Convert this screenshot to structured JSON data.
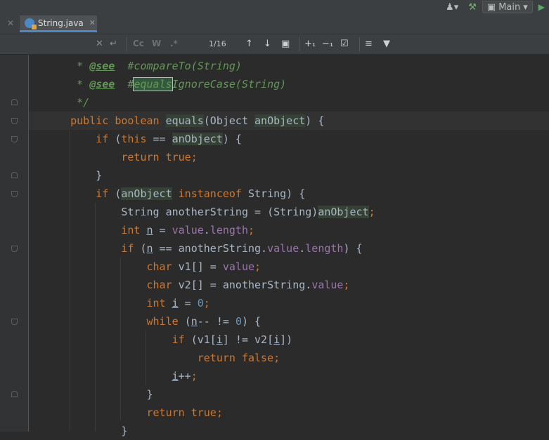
{
  "toolbar": {
    "run_config": "Main"
  },
  "tabs": [
    {
      "label": "String.java"
    }
  ],
  "search": {
    "match_case_label": "Cc",
    "words_label": "W",
    "regex_label": ".*",
    "match_count": "1/16"
  },
  "code": {
    "lines": [
      [
        {
          "t": "     * ",
          "c": "cm"
        },
        {
          "t": "@see",
          "c": "cmtag"
        },
        {
          "t": "  #compareTo(String)",
          "c": "cm"
        }
      ],
      [
        {
          "t": "     * ",
          "c": "cm"
        },
        {
          "t": "@see",
          "c": "cmtag"
        },
        {
          "t": "  #",
          "c": "cm"
        },
        {
          "t": "equals",
          "c": "cm hl-box"
        },
        {
          "t": "IgnoreCase(String)",
          "c": "cm"
        }
      ],
      [
        {
          "t": "     */",
          "c": "cm"
        }
      ],
      [
        {
          "t": "    public boolean ",
          "c": "kw"
        },
        {
          "t": "equals",
          "c": "hl"
        },
        {
          "t": "(Object "
        },
        {
          "t": "anObject",
          "c": "hl"
        },
        {
          "t": ") {"
        }
      ],
      [
        {
          "t": "        "
        },
        {
          "t": "if ",
          "c": "kw"
        },
        {
          "t": "("
        },
        {
          "t": "this ",
          "c": "kw"
        },
        {
          "t": "== "
        },
        {
          "t": "anObject",
          "c": "hl"
        },
        {
          "t": ") {"
        }
      ],
      [
        {
          "t": "            "
        },
        {
          "t": "return true",
          "c": "kw"
        },
        {
          "t": ";",
          "c": "kw"
        }
      ],
      [
        {
          "t": "        }"
        }
      ],
      [
        {
          "t": "        "
        },
        {
          "t": "if ",
          "c": "kw"
        },
        {
          "t": "("
        },
        {
          "t": "anObject",
          "c": "hl"
        },
        {
          "t": " "
        },
        {
          "t": "instanceof ",
          "c": "kw"
        },
        {
          "t": "String) {"
        }
      ],
      [
        {
          "t": "            String anotherString = (String)"
        },
        {
          "t": "anObject",
          "c": "hl"
        },
        {
          "t": ";",
          "c": "kw"
        }
      ],
      [
        {
          "t": "            "
        },
        {
          "t": "int ",
          "c": "kw"
        },
        {
          "t": "n",
          "c": "ul"
        },
        {
          "t": " = "
        },
        {
          "t": "value",
          "c": "fld"
        },
        {
          "t": "."
        },
        {
          "t": "length",
          "c": "fld"
        },
        {
          "t": ";",
          "c": "kw"
        }
      ],
      [
        {
          "t": "            "
        },
        {
          "t": "if ",
          "c": "kw"
        },
        {
          "t": "("
        },
        {
          "t": "n",
          "c": "ul"
        },
        {
          "t": " == anotherString."
        },
        {
          "t": "value",
          "c": "fld"
        },
        {
          "t": "."
        },
        {
          "t": "length",
          "c": "fld"
        },
        {
          "t": ") {"
        }
      ],
      [
        {
          "t": "                "
        },
        {
          "t": "char ",
          "c": "kw"
        },
        {
          "t": "v1[] = "
        },
        {
          "t": "value",
          "c": "fld"
        },
        {
          "t": ";",
          "c": "kw"
        }
      ],
      [
        {
          "t": "                "
        },
        {
          "t": "char ",
          "c": "kw"
        },
        {
          "t": "v2[] = anotherString."
        },
        {
          "t": "value",
          "c": "fld"
        },
        {
          "t": ";",
          "c": "kw"
        }
      ],
      [
        {
          "t": "                "
        },
        {
          "t": "int ",
          "c": "kw"
        },
        {
          "t": "i",
          "c": "ul"
        },
        {
          "t": " = "
        },
        {
          "t": "0",
          "c": "num"
        },
        {
          "t": ";",
          "c": "kw"
        }
      ],
      [
        {
          "t": "                "
        },
        {
          "t": "while ",
          "c": "kw"
        },
        {
          "t": "("
        },
        {
          "t": "n",
          "c": "ul"
        },
        {
          "t": "-- != "
        },
        {
          "t": "0",
          "c": "num"
        },
        {
          "t": ") {"
        }
      ],
      [
        {
          "t": "                    "
        },
        {
          "t": "if ",
          "c": "kw"
        },
        {
          "t": "(v1["
        },
        {
          "t": "i",
          "c": "ul"
        },
        {
          "t": "] != v2["
        },
        {
          "t": "i",
          "c": "ul"
        },
        {
          "t": "])"
        }
      ],
      [
        {
          "t": "                        "
        },
        {
          "t": "return false",
          "c": "kw"
        },
        {
          "t": ";",
          "c": "kw"
        }
      ],
      [
        {
          "t": "                    "
        },
        {
          "t": "i",
          "c": "ul"
        },
        {
          "t": "++"
        },
        {
          "t": ";",
          "c": "kw"
        }
      ],
      [
        {
          "t": "                }"
        }
      ],
      [
        {
          "t": "                "
        },
        {
          "t": "return true",
          "c": "kw"
        },
        {
          "t": ";",
          "c": "kw"
        }
      ],
      [
        {
          "t": "            }"
        }
      ]
    ]
  }
}
